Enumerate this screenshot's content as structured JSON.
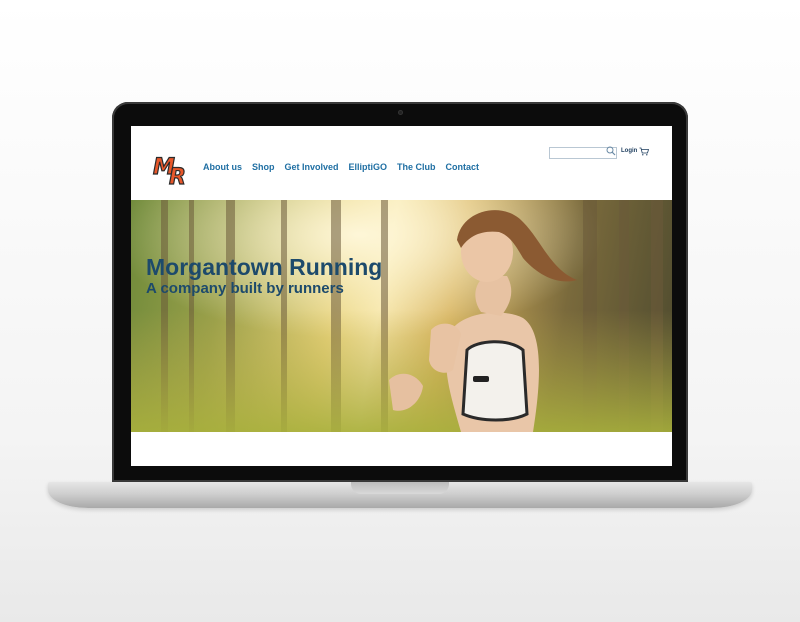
{
  "site": {
    "logo_text": "MR",
    "nav": [
      {
        "label": "About us"
      },
      {
        "label": "Shop"
      },
      {
        "label": "Get Involved"
      },
      {
        "label": "ElliptiGO"
      },
      {
        "label": "The Club"
      },
      {
        "label": "Contact"
      }
    ],
    "search": {
      "value": "",
      "placeholder": ""
    },
    "login_label": "Login"
  },
  "hero": {
    "title": "Morgantown Running",
    "subtitle": "A company built by runners"
  },
  "colors": {
    "brand_orange": "#e8572a",
    "nav_blue": "#1f6fa3",
    "heading_navy": "#1d4a6b"
  }
}
